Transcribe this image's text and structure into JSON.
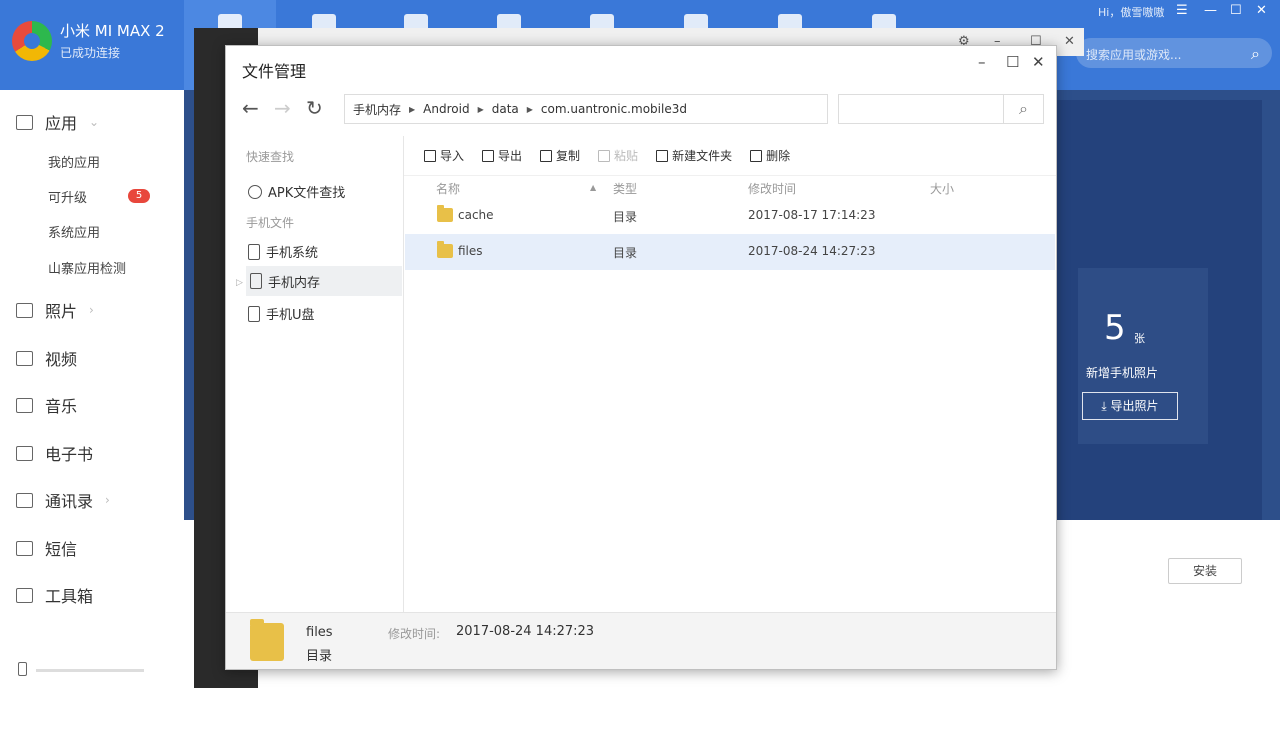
{
  "header": {
    "device_name": "小米 MI MAX 2",
    "connection_status": "已成功连接",
    "user_text": "Hi，傲雪嗷嗷",
    "search_placeholder": "搜索应用或游戏..."
  },
  "sidebar": {
    "apps_label": "应用",
    "apps_subitems": [
      "我的应用",
      "可升级",
      "系统应用",
      "山寨应用检测"
    ],
    "upgrade_badge": "5",
    "items": [
      "照片",
      "视频",
      "音乐",
      "电子书",
      "通讯录",
      "短信",
      "工具箱"
    ]
  },
  "background": {
    "photo_count": "5",
    "photo_unit": "张",
    "photo_label": "新增手机照片",
    "export_button": "导出照片",
    "install_button": "安装"
  },
  "file_manager": {
    "title": "文件管理",
    "path": [
      "手机内存",
      "Android",
      "data",
      "com.uantronic.mobile3d"
    ],
    "left_panel": {
      "quick_find_title": "快速查找",
      "apk_finder": "APK文件查找",
      "phone_files_title": "手机文件",
      "locations": [
        "手机系统",
        "手机内存",
        "手机U盘"
      ]
    },
    "toolbar": {
      "import": "导入",
      "export": "导出",
      "copy": "复制",
      "paste": "粘贴",
      "new_folder": "新建文件夹",
      "delete": "删除"
    },
    "columns": {
      "name": "名称",
      "type": "类型",
      "modified": "修改时间",
      "size": "大小"
    },
    "files": [
      {
        "name": "cache",
        "type": "目录",
        "modified": "2017-08-17 17:14:23",
        "size": ""
      },
      {
        "name": "files",
        "type": "目录",
        "modified": "2017-08-24 14:27:23",
        "size": ""
      }
    ],
    "details": {
      "name": "files",
      "type": "目录",
      "modified_label": "修改时间:",
      "modified_value": "2017-08-24 14:27:23"
    }
  }
}
